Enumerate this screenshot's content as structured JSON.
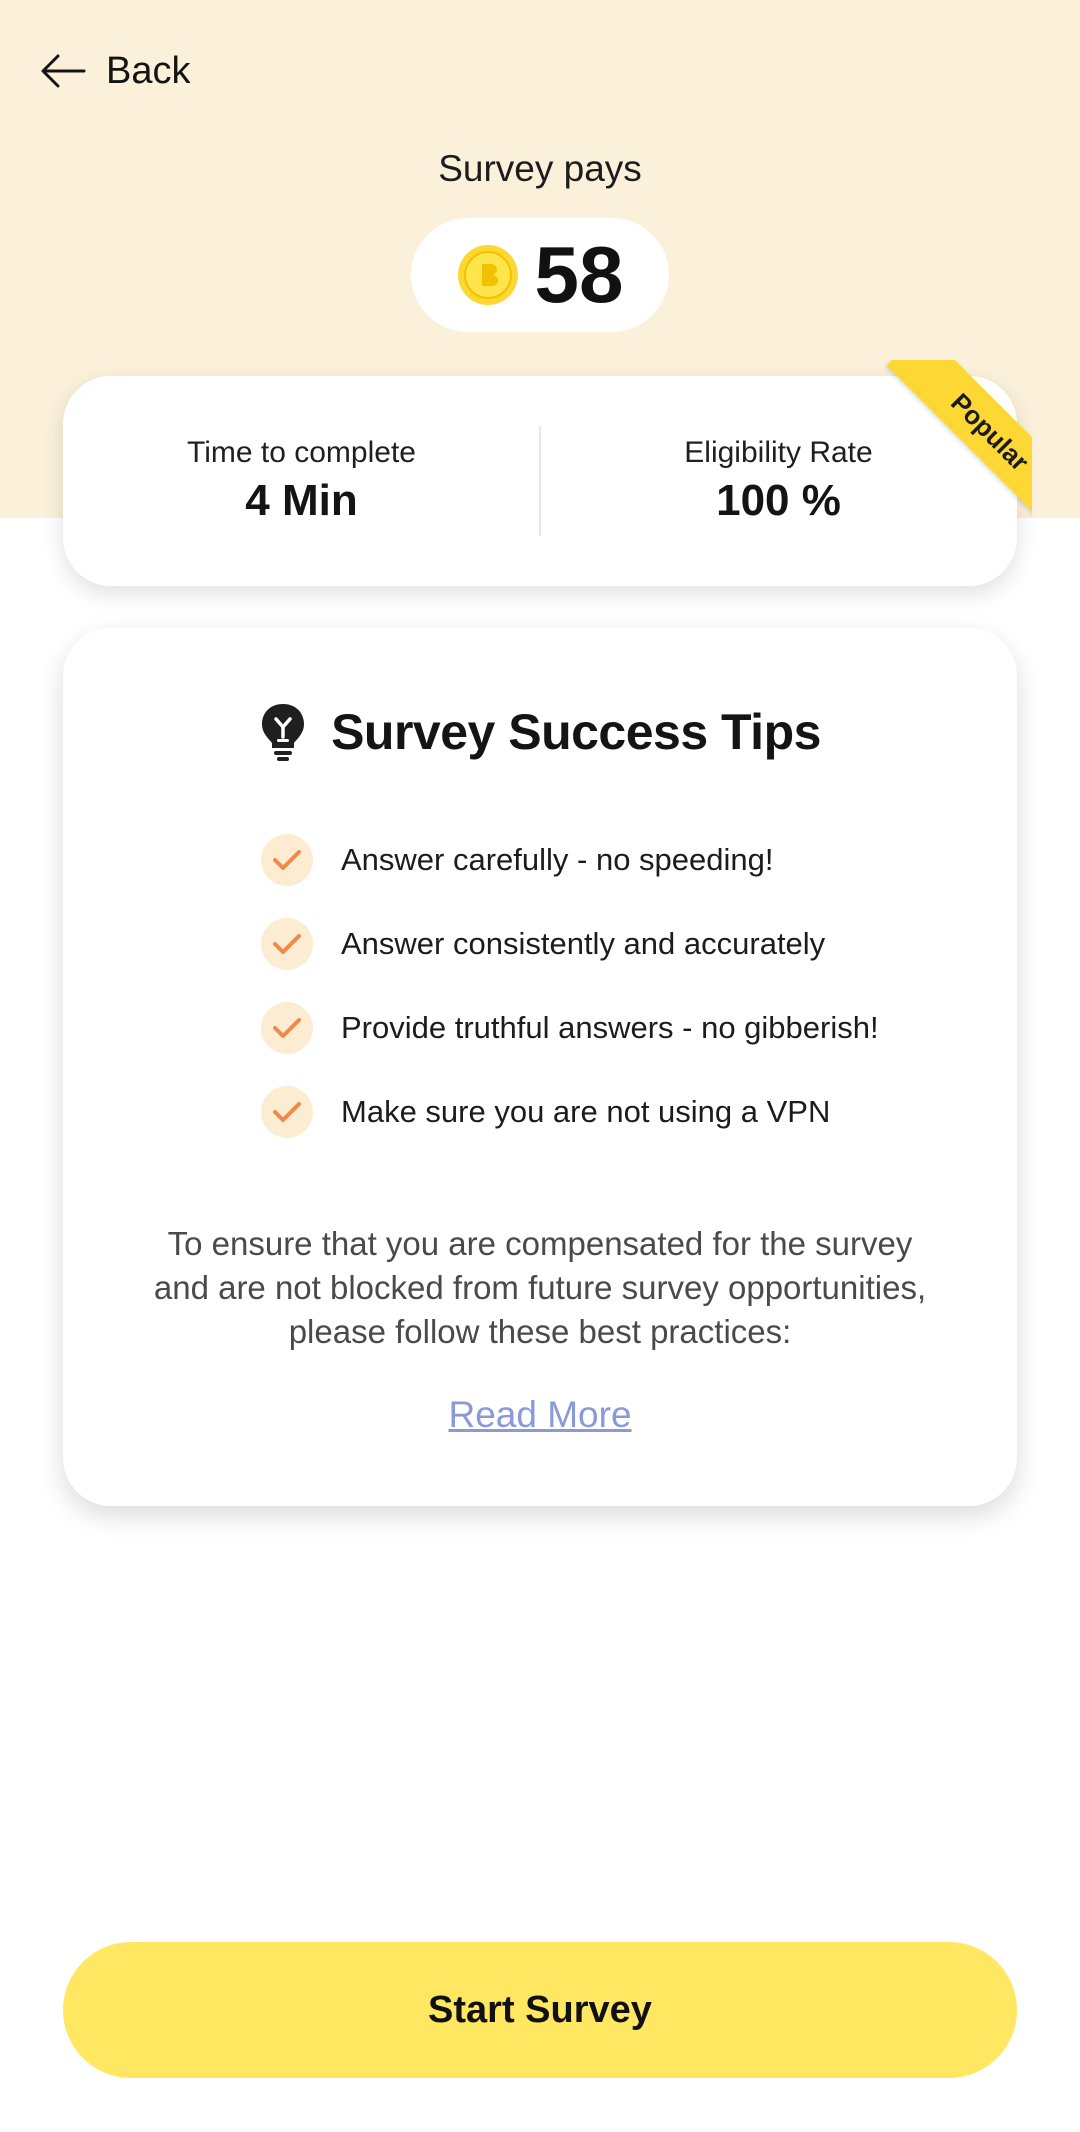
{
  "header": {
    "back_label": "Back",
    "pays_label": "Survey pays",
    "reward_amount": "58",
    "coin_icon": "coin-icon"
  },
  "stats": {
    "time_label": "Time to complete",
    "time_value": "4 Min",
    "eligibility_label": "Eligibility Rate",
    "eligibility_value": "100 %",
    "badge": "Popular"
  },
  "tips": {
    "title": "Survey Success Tips",
    "items": [
      "Answer carefully - no speeding!",
      "Answer consistently and accurately",
      "Provide truthful answers - no gibberish!",
      "Make sure you are not using a VPN"
    ],
    "note": "To ensure that you are compensated for the survey and are not blocked from future survey opportunities, please follow these best practices:",
    "read_more": "Read More"
  },
  "cta": {
    "start_label": "Start Survey"
  },
  "colors": {
    "header_bg": "#fbf1da",
    "accent_yellow": "#ffe761",
    "badge_yellow": "#fdd835",
    "check_orange": "#f0894a",
    "link": "#8a9ad8"
  }
}
